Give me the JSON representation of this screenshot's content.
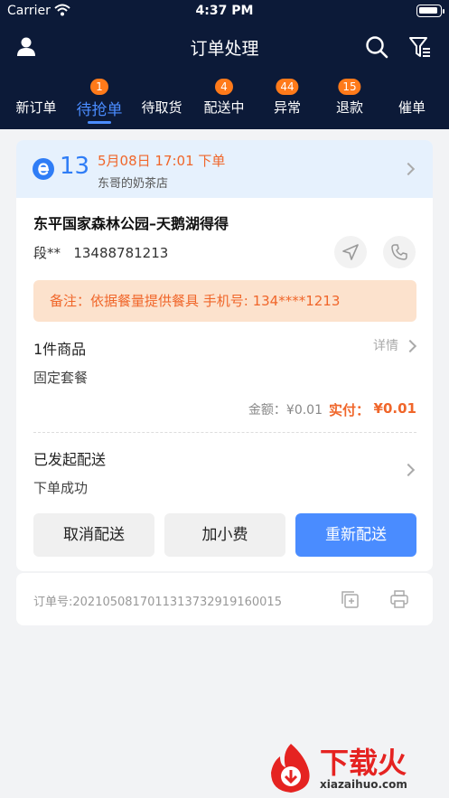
{
  "status_bar": {
    "carrier": "Carrier",
    "time": "4:37 PM"
  },
  "nav": {
    "title": "订单处理"
  },
  "tabs": [
    {
      "label": "新订单",
      "badge": ""
    },
    {
      "label": "待抢单",
      "badge": "1"
    },
    {
      "label": "待取货",
      "badge": ""
    },
    {
      "label": "配送中",
      "badge": "4"
    },
    {
      "label": "异常",
      "badge": "44"
    },
    {
      "label": "退款",
      "badge": "15"
    },
    {
      "label": "催单",
      "badge": ""
    }
  ],
  "order": {
    "number": "13",
    "time": "5月08日 17:01 下单",
    "store": "东哥的奶茶店",
    "address": "东平国家森林公园–天鹅湖得得",
    "customer_name": "段**",
    "customer_phone": "13488781213",
    "remark": "备注：依据餐量提供餐具 手机号: 134****1213",
    "goods_count": "1件商品",
    "details_label": "详情",
    "goods_name": "固定套餐",
    "amount_label": "金额：¥0.01",
    "paid_label": "实付：",
    "paid_value": "¥0.01",
    "delivery_title": "已发起配送",
    "delivery_status": "下单成功",
    "buttons": {
      "cancel": "取消配送",
      "tip": "加小费",
      "resend": "重新配送"
    },
    "order_id": "订单号:20210508170113137329191600​15"
  },
  "watermark": {
    "text": "下载火",
    "url": "xiazaihuo.com"
  },
  "colors": {
    "header_bg": "#0c1a38",
    "accent_blue": "#4a8cff",
    "accent_orange": "#f0662a",
    "badge_orange": "#ff7a1a"
  }
}
